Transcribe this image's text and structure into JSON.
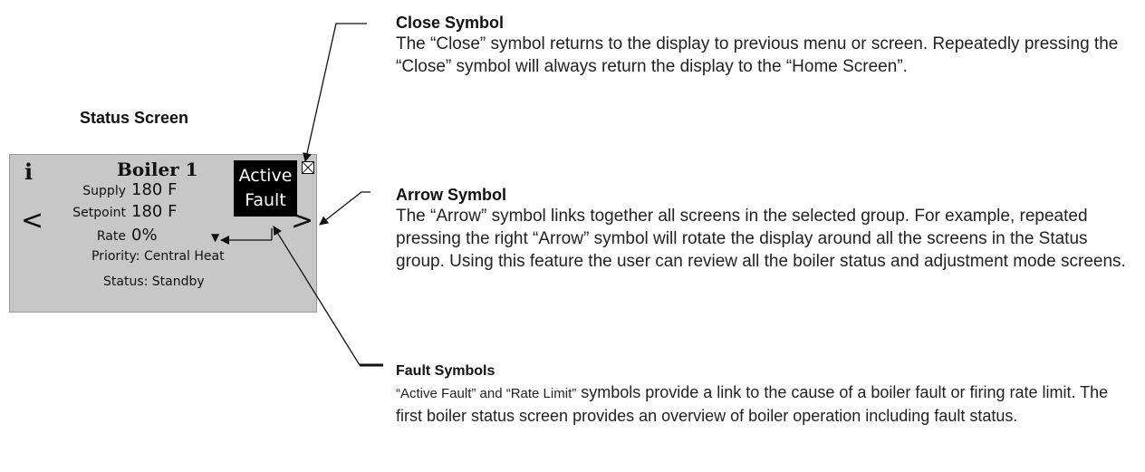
{
  "status_screen_caption": "Status Screen",
  "screen": {
    "info_icon": "i",
    "title": "Boiler 1",
    "supply_label": "Supply",
    "supply_value": "180 F",
    "setpoint_label": "Setpoint",
    "setpoint_value": "180 F",
    "rate_label": "Rate",
    "rate_value": "0%",
    "priority": "Priority: Central Heat",
    "status": "Status: Standby",
    "fault_line1": "Active",
    "fault_line2": "Fault",
    "nav_left": "<",
    "nav_right": ">",
    "rate_limit_icon": "down-triangle-icon",
    "close_icon": "close-box-icon"
  },
  "notes": {
    "close": {
      "title": "Close Symbol",
      "body": "The “Close” symbol returns to the display to previous menu or screen. Repeatedly pressing the “Close” symbol will always return the display to the “Home Screen”."
    },
    "arrow": {
      "title": "Arrow Symbol",
      "body": "The “Arrow” symbol links together all screens in the selected group. For example, repeated pressing the right “Arrow” symbol will rotate the display around all the screens in the Status group. Using this feature the user can review all the boiler status and adjustment mode screens."
    },
    "fault": {
      "title": "Fault Symbols",
      "body_small": "“Active Fault” and “Rate Limit”",
      "body": " symbols provide a link to the cause of a boiler fault or firing rate limit. The first boiler status screen provides an overview of boiler operation including fault status."
    }
  }
}
